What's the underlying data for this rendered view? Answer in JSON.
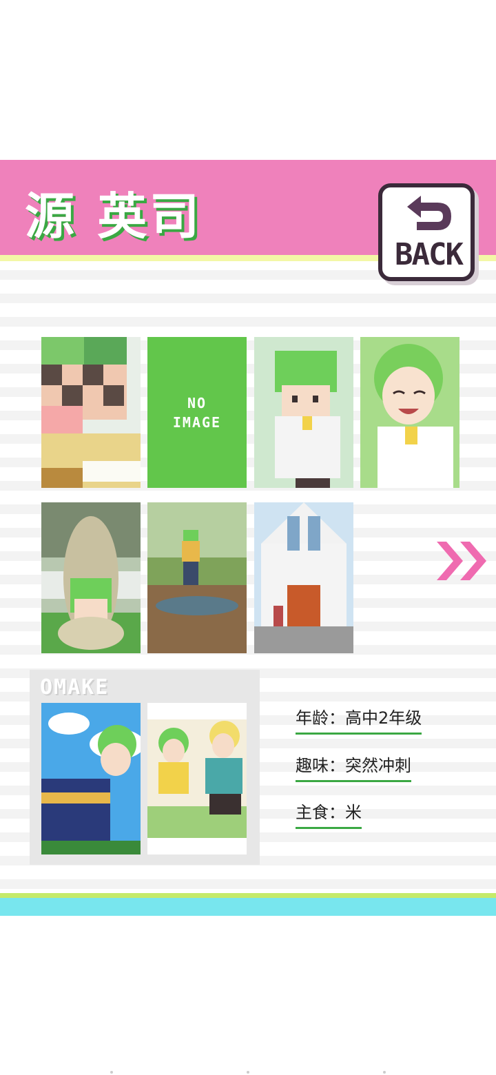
{
  "header": {
    "title": "源 英司",
    "back_label": "BACK",
    "colors": {
      "bar": "#ef81bb",
      "title_shadow": "#3aa843",
      "stripe": "#f3f7a6"
    }
  },
  "gallery": {
    "no_image_line1": "NO",
    "no_image_line2": "IMAGE",
    "next_icon": "double-chevron-right-icon"
  },
  "omake": {
    "title": "OMAKE"
  },
  "profile": {
    "age": "年龄：高中2年级",
    "hobby": "趣味：突然冲刺",
    "staple": "主食：米"
  }
}
